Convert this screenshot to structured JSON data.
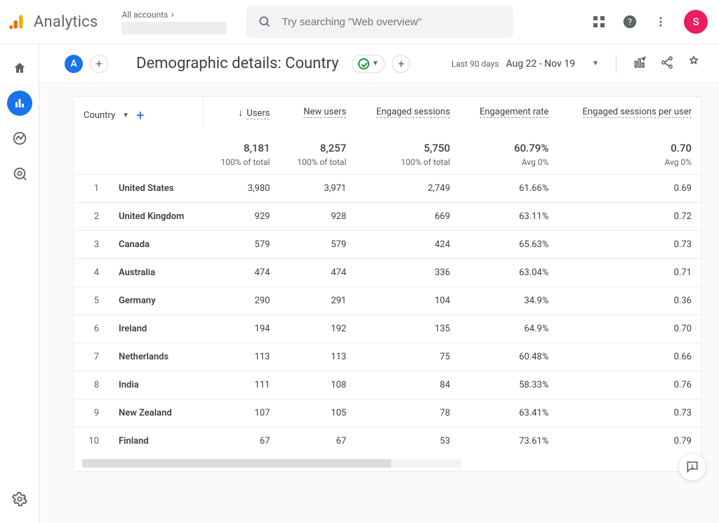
{
  "header": {
    "product": "Analytics",
    "accounts_label": "All accounts",
    "search_placeholder": "Try searching \"Web overview\"",
    "avatar_initial": "S"
  },
  "toolbar": {
    "segment_letter": "A",
    "title": "Demographic details: Country",
    "date_label": "Last 90 days",
    "date_range": "Aug 22 - Nov 19"
  },
  "table": {
    "dimension_label": "Country",
    "columns": [
      {
        "label": "Users",
        "sorted": true
      },
      {
        "label": "New users",
        "sorted": false
      },
      {
        "label": "Engaged sessions",
        "sorted": false
      },
      {
        "label": "Engagement rate",
        "sorted": false
      },
      {
        "label": "Engaged sessions per user",
        "sorted": false
      }
    ],
    "totals": {
      "values": [
        "8,181",
        "8,257",
        "5,750",
        "60.79%",
        "0.70"
      ],
      "subs": [
        "100% of total",
        "100% of total",
        "100% of total",
        "Avg 0%",
        "Avg 0%"
      ]
    },
    "rows": [
      {
        "idx": 1,
        "name": "United States",
        "values": [
          "3,980",
          "3,971",
          "2,749",
          "61.66%",
          "0.69"
        ]
      },
      {
        "idx": 2,
        "name": "United Kingdom",
        "values": [
          "929",
          "928",
          "669",
          "63.11%",
          "0.72"
        ]
      },
      {
        "idx": 3,
        "name": "Canada",
        "values": [
          "579",
          "579",
          "424",
          "65.63%",
          "0.73"
        ]
      },
      {
        "idx": 4,
        "name": "Australia",
        "values": [
          "474",
          "474",
          "336",
          "63.04%",
          "0.71"
        ]
      },
      {
        "idx": 5,
        "name": "Germany",
        "values": [
          "290",
          "291",
          "104",
          "34.9%",
          "0.36"
        ]
      },
      {
        "idx": 6,
        "name": "Ireland",
        "values": [
          "194",
          "192",
          "135",
          "64.9%",
          "0.70"
        ]
      },
      {
        "idx": 7,
        "name": "Netherlands",
        "values": [
          "113",
          "113",
          "75",
          "60.48%",
          "0.66"
        ]
      },
      {
        "idx": 8,
        "name": "India",
        "values": [
          "111",
          "108",
          "84",
          "58.33%",
          "0.76"
        ]
      },
      {
        "idx": 9,
        "name": "New Zealand",
        "values": [
          "107",
          "105",
          "78",
          "63.41%",
          "0.73"
        ]
      },
      {
        "idx": 10,
        "name": "Finland",
        "values": [
          "67",
          "67",
          "53",
          "73.61%",
          "0.79"
        ]
      }
    ]
  },
  "chart_data": {
    "type": "table",
    "title": "Demographic details: Country — Last 90 days (Aug 22 - Nov 19)",
    "columns": [
      "Country",
      "Users",
      "New users",
      "Engaged sessions",
      "Engagement rate",
      "Engaged sessions per user"
    ],
    "totals": [
      "(total)",
      8181,
      8257,
      5750,
      0.6079,
      0.7
    ],
    "rows": [
      [
        "United States",
        3980,
        3971,
        2749,
        0.6166,
        0.69
      ],
      [
        "United Kingdom",
        929,
        928,
        669,
        0.6311,
        0.72
      ],
      [
        "Canada",
        579,
        579,
        424,
        0.6563,
        0.73
      ],
      [
        "Australia",
        474,
        474,
        336,
        0.6304,
        0.71
      ],
      [
        "Germany",
        290,
        291,
        104,
        0.349,
        0.36
      ],
      [
        "Ireland",
        194,
        192,
        135,
        0.649,
        0.7
      ],
      [
        "Netherlands",
        113,
        113,
        75,
        0.6048,
        0.66
      ],
      [
        "India",
        111,
        108,
        84,
        0.5833,
        0.76
      ],
      [
        "New Zealand",
        107,
        105,
        78,
        0.6341,
        0.73
      ],
      [
        "Finland",
        67,
        67,
        53,
        0.7361,
        0.79
      ]
    ]
  }
}
